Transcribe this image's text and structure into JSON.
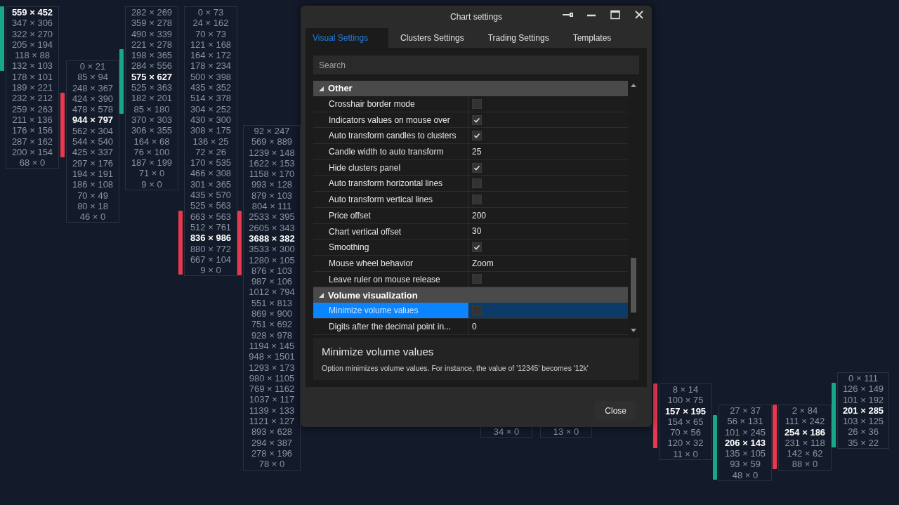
{
  "chart": {
    "clusters": [
      {
        "candle": {
          "color": "#17a88a"
        },
        "poc": "559 × 452",
        "below": [
          "347 × 306",
          "322 × 270",
          "205 × 194",
          "118 × 88",
          "132 × 103",
          "178 × 101",
          "189 × 221",
          "232 × 212",
          "259 × 263",
          "211 × 136",
          "176 × 156",
          "287 × 162",
          "200 × 154",
          "68 × 0"
        ]
      },
      {
        "candle": {
          "color": "#e8384f"
        },
        "above": [
          "0 × 21",
          "85 × 94",
          "248 × 367",
          "424 × 390",
          "478 × 578"
        ],
        "poc": "944 × 797",
        "below": [
          "562 × 304",
          "544 × 540",
          "425 × 337",
          "297 × 176",
          "194 × 191",
          "186 × 108",
          "70 × 49",
          "80 × 18",
          "46 × 0"
        ]
      },
      {
        "candle": {
          "color": "#17a88a"
        },
        "above": [
          "282 × 269",
          "359 × 278",
          "490 × 339",
          "221 × 278",
          "198 × 365",
          "284 × 556"
        ],
        "poc": "575 × 627",
        "below": [
          "525 × 363",
          "182 × 201",
          "85 × 180",
          "370 × 303",
          "306 × 355",
          "164 × 68",
          "76 × 100",
          "187 × 199",
          "71 × 0",
          "9 × 0"
        ]
      },
      {
        "candle": {
          "color": "#e8384f"
        },
        "above": [
          "0 × 73",
          "24 × 162",
          "70 × 73",
          "121 × 168",
          "164 × 172",
          "178 × 234",
          "500 × 398",
          "435 × 352",
          "514 × 378",
          "304 × 252",
          "430 × 300",
          "308 × 175",
          "136 × 25",
          "72 × 26",
          "170 × 535",
          "466 × 308",
          "301 × 365",
          "435 × 570",
          "525 × 563",
          "663 × 563",
          "512 × 761"
        ],
        "poc": "836 × 986",
        "below": [
          "880 × 772",
          "667 × 104",
          "9 × 0"
        ]
      },
      {
        "candle": {
          "color": "#e8384f"
        },
        "above": [
          "92 × 247",
          "569 × 889",
          "1239 × 148",
          "1622 × 153",
          "1158 × 170",
          "993 × 128",
          "879 × 103",
          "804 × 111",
          "2533 × 395",
          "2605 × 343"
        ],
        "poc": "3688 × 382",
        "below": [
          "3533 × 300",
          "1280 × 105",
          "876 × 103",
          "987 × 106",
          "1012 × 794",
          "551 × 813",
          "869 × 900",
          "751 × 692",
          "928 × 978",
          "1194 × 145",
          "948 × 1501",
          "1293 × 173",
          "980 × 1105",
          "769 × 1162",
          "1037 × 117",
          "1139 × 133",
          "1121 × 127",
          "893 × 628",
          "294 × 387",
          "278 × 196",
          "78 × 0"
        ]
      },
      {
        "above": [
          "34 × 0"
        ]
      },
      {
        "above": [
          "13 × 0"
        ]
      },
      {
        "candle": {
          "color": "#e8384f"
        },
        "above": [
          "8 × 14",
          "100 × 75"
        ],
        "poc": "157 × 195",
        "below": [
          "154 × 65",
          "70 × 56",
          "120 × 32",
          "11 × 0"
        ]
      },
      {
        "candle": {
          "color": "#17a88a"
        },
        "above": [
          "27 × 37",
          "56 × 131",
          "101 × 245"
        ],
        "poc": "206 × 143",
        "below": [
          "135 × 105",
          "93 × 59",
          "48 × 0"
        ]
      },
      {
        "candle": {
          "color": "#e8384f"
        },
        "above": [
          "2 × 84",
          "111 × 242"
        ],
        "poc": "254 × 186",
        "below": [
          "231 × 118",
          "142 × 62",
          "88 × 0"
        ]
      },
      {
        "candle": {
          "color": "#17a88a"
        },
        "above": [
          "0 × 111",
          "126 × 149",
          "101 × 192"
        ],
        "poc": "201 × 285",
        "below": [
          "103 × 125",
          "26 × 36",
          "35 × 22"
        ]
      }
    ]
  },
  "dialog": {
    "title": "Chart settings",
    "tabs": [
      {
        "label": "Visual Settings",
        "selected": true
      },
      {
        "label": "Clusters Settings",
        "selected": false
      },
      {
        "label": "Trading Settings",
        "selected": false
      },
      {
        "label": "Templates",
        "selected": false
      }
    ],
    "search": {
      "placeholder": "Search"
    },
    "categories": [
      {
        "name": "Other",
        "expanded": true,
        "properties": [
          {
            "name": "Crosshair border mode",
            "kind": "check",
            "checked": false,
            "selected": false
          },
          {
            "name": "Indicators values on mouse over",
            "kind": "check",
            "checked": true,
            "selected": false
          },
          {
            "name": "Auto transform candles to clusters",
            "kind": "check",
            "checked": true,
            "selected": false
          },
          {
            "name": "Candle width to auto transform",
            "kind": "text",
            "value": "25",
            "selected": false
          },
          {
            "name": "Hide clusters panel",
            "kind": "check",
            "checked": true,
            "selected": false
          },
          {
            "name": "Auto transform horizontal lines",
            "kind": "check",
            "checked": false,
            "selected": false
          },
          {
            "name": "Auto transform vertical lines",
            "kind": "check",
            "checked": false,
            "selected": false
          },
          {
            "name": "Price offset",
            "kind": "text",
            "value": "200",
            "selected": false
          },
          {
            "name": "Chart vertical offset",
            "kind": "text",
            "value": "30",
            "selected": false
          },
          {
            "name": "Smoothing",
            "kind": "check",
            "checked": true,
            "selected": false
          },
          {
            "name": "Mouse wheel behavior",
            "kind": "text",
            "value": "Zoom",
            "selected": false
          },
          {
            "name": "Leave ruler on mouse release",
            "kind": "check",
            "checked": false,
            "selected": false
          }
        ]
      },
      {
        "name": "Volume visualization",
        "expanded": true,
        "properties": [
          {
            "name": "Minimize volume values",
            "kind": "check",
            "checked": false,
            "selected": true
          },
          {
            "name": "Digits after the decimal point in...",
            "kind": "text",
            "value": "0",
            "selected": false
          }
        ]
      }
    ],
    "description": {
      "title": "Minimize volume values",
      "text": "Option minimizes volume values. For instance, the value of '12345' becomes '12k'"
    },
    "close_button": "Close"
  }
}
